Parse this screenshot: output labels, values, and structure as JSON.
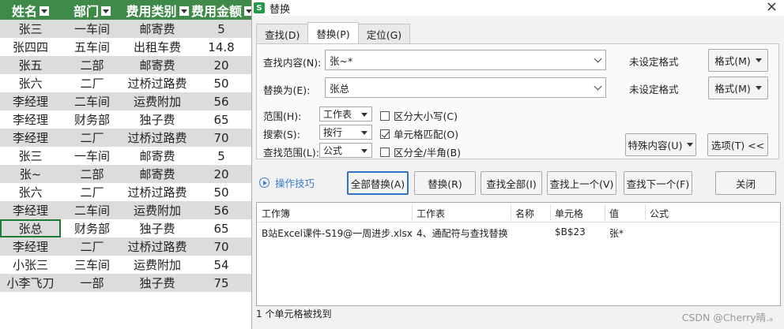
{
  "sheet": {
    "headers": [
      "姓名",
      "部门",
      "费用类别",
      "费用金额"
    ],
    "rows": [
      [
        "张三",
        "一车间",
        "邮寄费",
        "5"
      ],
      [
        "张四四",
        "五车间",
        "出租车费",
        "14.8"
      ],
      [
        "张五",
        "二部",
        "邮寄费",
        "20"
      ],
      [
        "张六",
        "二厂",
        "过桥过路费",
        "50"
      ],
      [
        "李经理",
        "二车间",
        "运费附加",
        "56"
      ],
      [
        "李经理",
        "财务部",
        "独子费",
        "65"
      ],
      [
        "李经理",
        "二厂",
        "过桥过路费",
        "70"
      ],
      [
        "张三",
        "一车间",
        "邮寄费",
        "5"
      ],
      [
        "张~",
        "二部",
        "邮寄费",
        "20"
      ],
      [
        "张六",
        "二厂",
        "过桥过路费",
        "50"
      ],
      [
        "李经理",
        "二车间",
        "运费附加",
        "56"
      ],
      [
        "张总",
        "财务部",
        "独子费",
        "65"
      ],
      [
        "李经理",
        "二厂",
        "过桥过路费",
        "70"
      ],
      [
        "小张三",
        "三车间",
        "运费附加",
        "54"
      ],
      [
        "小李飞刀",
        "一部",
        "独子费",
        "75"
      ]
    ],
    "colors": {
      "header_bg": "#3f8a48",
      "shade": "#dcdcdc",
      "active_border": "#1e7a34"
    }
  },
  "dialog": {
    "app_logo": "S",
    "title": "替换",
    "close_icon": "×",
    "tabs": [
      "查找(D)",
      "替换(P)",
      "定位(G)"
    ],
    "active_tab": 1,
    "find": {
      "label": "查找内容(N):",
      "value": "张~*",
      "format_status": "未设定格式",
      "format_button": "格式(M)"
    },
    "replace": {
      "label": "替换为(E):",
      "value": "张总",
      "format_status": "未设定格式",
      "format_button": "格式(M)"
    },
    "scope": {
      "label": "范围(H):",
      "value": "工作表"
    },
    "search": {
      "label": "搜索(S):",
      "value": "按行"
    },
    "look_in": {
      "label": "查找范围(L):",
      "value": "公式"
    },
    "options": {
      "match_case": {
        "label": "区分大小写(C)",
        "checked": false
      },
      "match_cell": {
        "label": "单元格匹配(O)",
        "checked": true
      },
      "match_width": {
        "label": "区分全/半角(B)",
        "checked": false
      }
    },
    "special_button": "特殊内容(U)",
    "options_button": "选项(T) <<",
    "tips_link": "操作技巧",
    "actions": {
      "replace_all": "全部替换(A)",
      "replace": "替换(R)",
      "find_all": "查找全部(I)",
      "find_prev": "查找上一个(V)",
      "find_next": "查找下一个(F)",
      "close": "关闭"
    },
    "results": {
      "columns": [
        "工作簿",
        "工作表",
        "名称",
        "单元格",
        "值",
        "公式"
      ],
      "rows": [
        [
          "B站Excel课件-S19@一周进步.xlsx",
          "4、通配符与查找替换",
          "",
          "$B$23",
          "张*",
          ""
        ]
      ]
    },
    "status": "1 个单元格被找到",
    "watermark": "CSDN @Cherry晴.ₐ",
    "accent": "#2f74c8",
    "link_color": "#3a7bd5"
  }
}
